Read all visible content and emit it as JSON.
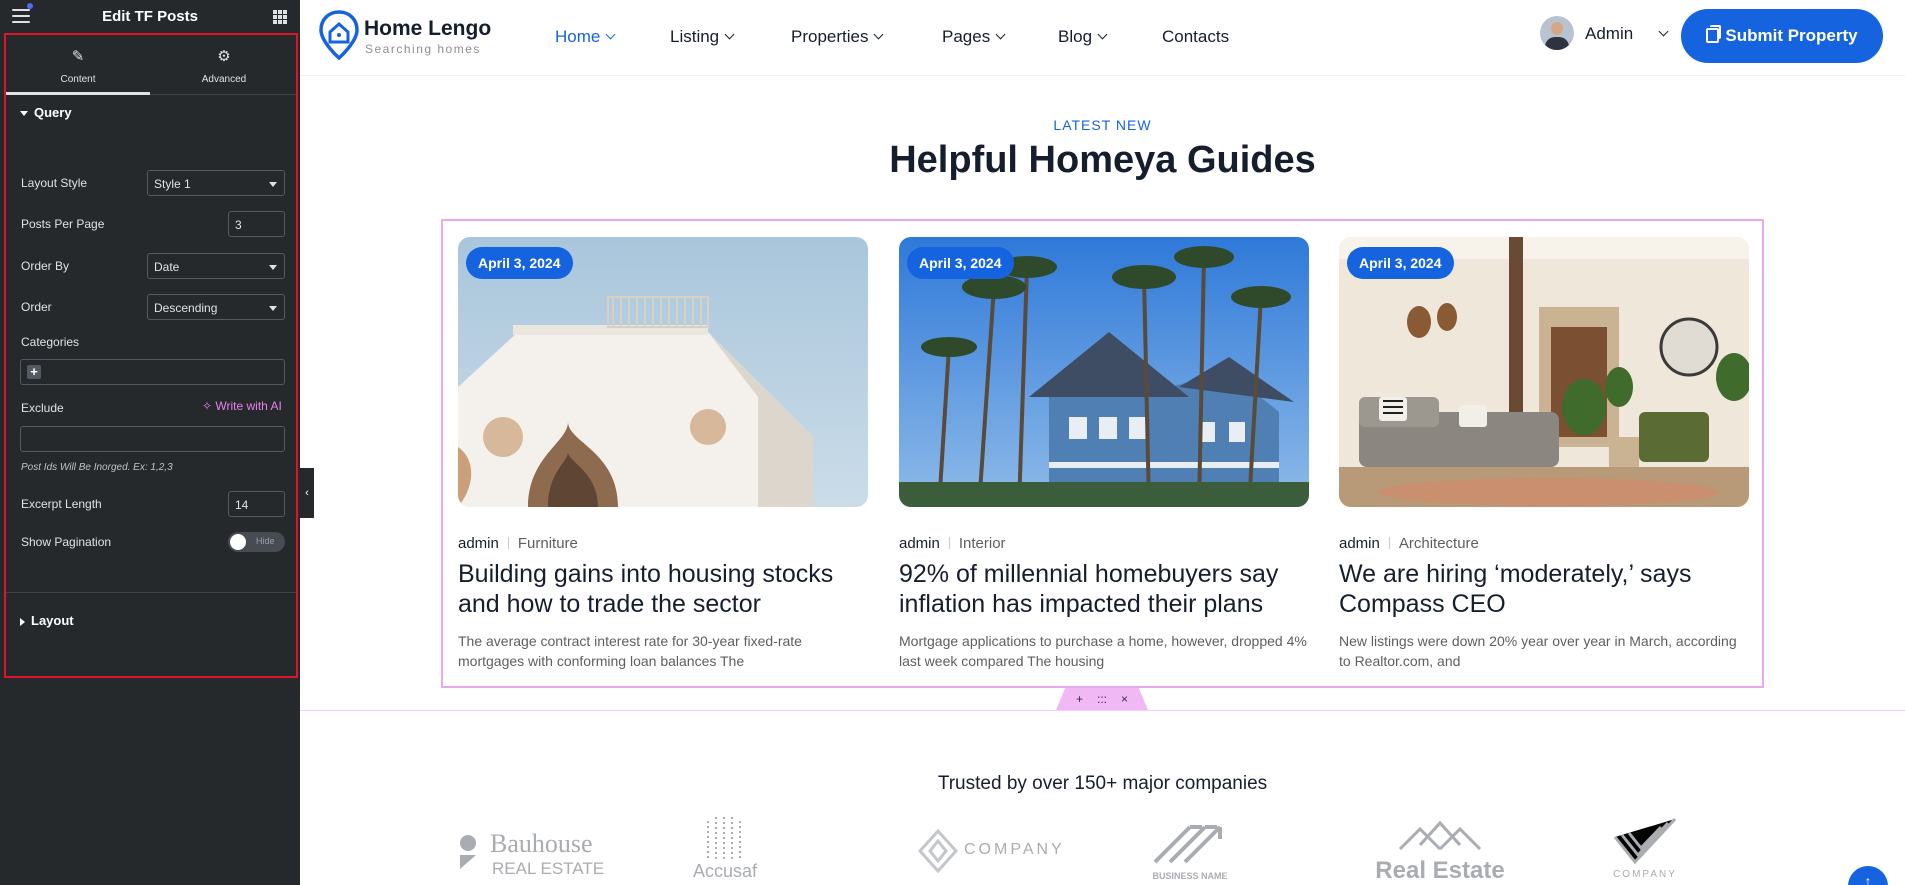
{
  "editor": {
    "title": "Edit TF Posts",
    "tabs": [
      {
        "label": "Content",
        "icon": "pencil-icon"
      },
      {
        "label": "Advanced",
        "icon": "gear-icon"
      }
    ],
    "query_section": "Query",
    "controls": {
      "layout_style": {
        "label": "Layout Style",
        "value": "Style 1"
      },
      "posts_per_page": {
        "label": "Posts Per Page",
        "value": "3"
      },
      "order_by": {
        "label": "Order By",
        "value": "Date"
      },
      "order": {
        "label": "Order",
        "value": "Descending"
      },
      "categories": {
        "label": "Categories",
        "add": "+"
      },
      "exclude": {
        "label": "Exclude",
        "ai": "Write with AI",
        "value": ""
      },
      "exclude_hint": "Post Ids Will Be Inorged. Ex: 1,2,3",
      "excerpt_length": {
        "label": "Excerpt Length",
        "value": "14"
      },
      "show_pagination": {
        "label": "Show Pagination",
        "toggle_text": "Hide",
        "on": false
      }
    },
    "layout_section": "Layout"
  },
  "site": {
    "logo": {
      "name": "Home Lengo",
      "tagline": "Searching homes"
    },
    "nav": [
      "Home",
      "Listing",
      "Properties",
      "Pages",
      "Blog",
      "Contacts"
    ],
    "user": "Admin",
    "cta": "Submit Property",
    "accent": "#1563df"
  },
  "section": {
    "eyebrow": "LATEST NEW",
    "title": "Helpful Homeya Guides",
    "posts": [
      {
        "date": "April 3, 2024",
        "author": "admin",
        "category": "Furniture",
        "title": "Building gains into housing stocks and how to trade the sector",
        "excerpt": "The average contract interest rate for 30-year fixed-rate mortgages with conforming loan balances The"
      },
      {
        "date": "April 3, 2024",
        "author": "admin",
        "category": "Interior",
        "title": "92% of millennial homebuyers say inflation has impacted their plans",
        "excerpt": "Mortgage applications to purchase a home, however, dropped 4% last week compared The housing"
      },
      {
        "date": "April 3, 2024",
        "author": "admin",
        "category": "Architecture",
        "title": "We are hiring ‘moderately,’ says Compass CEO",
        "excerpt": "New listings were down 20% year over year in March, according to Realtor.com, and"
      }
    ],
    "handle": {
      "add": "+",
      "move": ":::",
      "close": "×"
    }
  },
  "partners": {
    "heading": "Trusted by over 150+ major companies",
    "logos": [
      {
        "line1": "Bauhouse",
        "line2": "REAL ESTATE"
      },
      {
        "line1": "",
        "line2": "Accusaf"
      },
      {
        "line1": "COMPANY",
        "line2": ""
      },
      {
        "line1": "",
        "line2": "BUSINESS NAME"
      },
      {
        "line1": "",
        "line2": "Real Estate"
      },
      {
        "line1": "",
        "line2": "COMPANY"
      }
    ]
  }
}
